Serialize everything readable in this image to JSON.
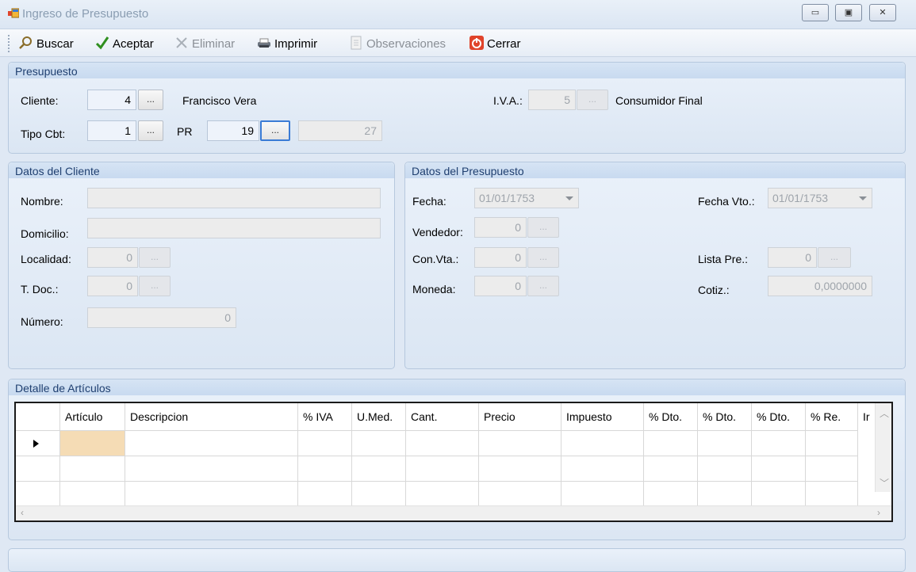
{
  "window": {
    "title": "Ingreso  de Presupuesto",
    "controls": [
      "minimize-icon",
      "maximize-icon",
      "close-icon"
    ]
  },
  "toolbar": {
    "buscar": "Buscar",
    "aceptar": "Aceptar",
    "eliminar": "Eliminar",
    "imprimir": "Imprimir",
    "observaciones": "Observaciones",
    "cerrar": "Cerrar"
  },
  "presupuesto": {
    "title": "Presupuesto",
    "cliente_label": "Cliente:",
    "cliente_code": "4",
    "cliente_name": "Francisco Vera",
    "iva_label": "I.V.A.:",
    "iva_code": "5",
    "iva_name": "Consumidor Final",
    "tipo_label": "Tipo Cbt:",
    "tipo_code": "1",
    "pr_label": "PR",
    "pr_code": "19",
    "numero": "27",
    "ellipsis": "..."
  },
  "cliente": {
    "title": "Datos del Cliente",
    "nombre_label": "Nombre:",
    "nombre_value": "",
    "domicilio_label": "Domicilio:",
    "domicilio_value": "",
    "localidad_label": "Localidad:",
    "localidad_value": "0",
    "tdoc_label": "T. Doc.:",
    "tdoc_value": "0",
    "numero_label": "Número:",
    "numero_value": "0"
  },
  "datos_presupuesto": {
    "title": "Datos del Presupuesto",
    "fecha_label": "Fecha:",
    "fecha_value": "01/01/1753",
    "fecha_vto_label": "Fecha Vto.:",
    "fecha_vto_value": "01/01/1753",
    "vendedor_label": "Vendedor:",
    "vendedor_value": "0",
    "convta_label": "Con.Vta.:",
    "convta_value": "0",
    "lista_label": "Lista Pre.:",
    "lista_value": "0",
    "moneda_label": "Moneda:",
    "moneda_value": "0",
    "cotiz_label": "Cotiz.:",
    "cotiz_value": "0,0000000"
  },
  "detalle": {
    "title": "Detalle de Artículos",
    "columns": [
      "Artículo",
      "Descripcion",
      "% IVA",
      "U.Med.",
      "Cant.",
      "Precio",
      "Impuesto",
      "% Dto.",
      "% Dto.",
      "% Dto.",
      "% Re.",
      "Ir"
    ]
  },
  "colors": {
    "accent": "#3a7bd5",
    "panel_title": "#1f3f70",
    "selected_cell": "#f5dcb5"
  }
}
